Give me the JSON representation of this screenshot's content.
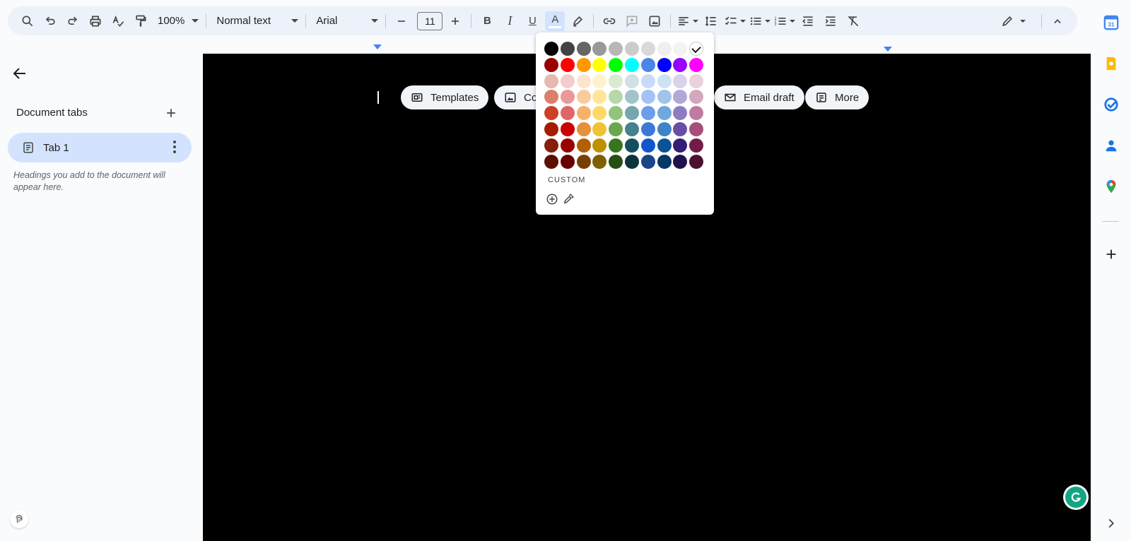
{
  "toolbar": {
    "zoom": "100%",
    "style": "Normal text",
    "font": "Arial",
    "font_size": "11",
    "icons": [
      "search-icon",
      "undo-icon",
      "redo-icon",
      "print-icon",
      "spellcheck-icon",
      "paint-format-icon",
      "decrease-font-icon",
      "increase-font-icon",
      "bold-icon",
      "italic-icon",
      "underline-icon",
      "text-color-icon",
      "highlight-icon",
      "link-icon",
      "add-comment-icon",
      "image-icon",
      "align-icon",
      "line-spacing-icon",
      "checklist-icon",
      "bullet-list-icon",
      "numbered-list-icon",
      "decrease-indent-icon",
      "increase-indent-icon",
      "clear-format-icon",
      "editing-mode-icon",
      "collapse-icon"
    ],
    "bold_label": "B",
    "italic_label": "I",
    "underline_label": "U",
    "text_color_label": "A"
  },
  "left_panel": {
    "title": "Document tabs",
    "tab": {
      "label": "Tab 1"
    },
    "hint": "Headings you add to the document will appear here."
  },
  "doc": {
    "background": "#000000",
    "chips": [
      {
        "label": "Templates",
        "icon": "templates-icon"
      },
      {
        "label": "Co",
        "icon": "image-icon"
      },
      {
        "label": "Email draft",
        "icon": "email-icon"
      },
      {
        "label": "More",
        "icon": "more-icon"
      }
    ]
  },
  "color_picker": {
    "selected": "#ffffff",
    "custom_label": "CUSTOM",
    "rows": [
      [
        "#000000",
        "#434343",
        "#666666",
        "#999999",
        "#b7b7b7",
        "#cccccc",
        "#d9d9d9",
        "#efefef",
        "#f3f3f3",
        "#ffffff"
      ],
      [
        "#980000",
        "#ff0000",
        "#ff9900",
        "#ffff00",
        "#00ff00",
        "#00ffff",
        "#4a86e8",
        "#0000ff",
        "#9900ff",
        "#ff00ff"
      ],
      [
        "#e6b8af",
        "#f4cccc",
        "#fce5cd",
        "#fff2cc",
        "#d9ead3",
        "#d0e0e3",
        "#c9daf8",
        "#cfe2f3",
        "#d9d2e9",
        "#ead1dc"
      ],
      [
        "#dd7e6b",
        "#ea9999",
        "#f9cb9c",
        "#ffe599",
        "#b6d7a8",
        "#a2c4c9",
        "#a4c2f4",
        "#9fc5e8",
        "#b4a7d6",
        "#d5a6bd"
      ],
      [
        "#cc4125",
        "#e06666",
        "#f6b26b",
        "#ffd966",
        "#93c47d",
        "#76a5af",
        "#6d9eeb",
        "#6fa8dc",
        "#8e7cc3",
        "#c27ba0"
      ],
      [
        "#a61c00",
        "#cc0000",
        "#e69138",
        "#f1c232",
        "#6aa84f",
        "#45818e",
        "#3c78d8",
        "#3d85c6",
        "#674ea7",
        "#a64d79"
      ],
      [
        "#85200c",
        "#990000",
        "#b45f06",
        "#bf9000",
        "#38761d",
        "#134f5c",
        "#1155cc",
        "#0b5394",
        "#351c75",
        "#741b47"
      ],
      [
        "#5b0f00",
        "#660000",
        "#783f04",
        "#7f6000",
        "#274e13",
        "#0c343d",
        "#1c4587",
        "#073763",
        "#20124d",
        "#4c1130"
      ]
    ]
  },
  "right_bar": {
    "icons": [
      "calendar-icon",
      "keep-icon",
      "tasks-icon",
      "contacts-icon",
      "maps-icon",
      "add-icon",
      "expand-icon"
    ],
    "calendar_day": "31"
  }
}
